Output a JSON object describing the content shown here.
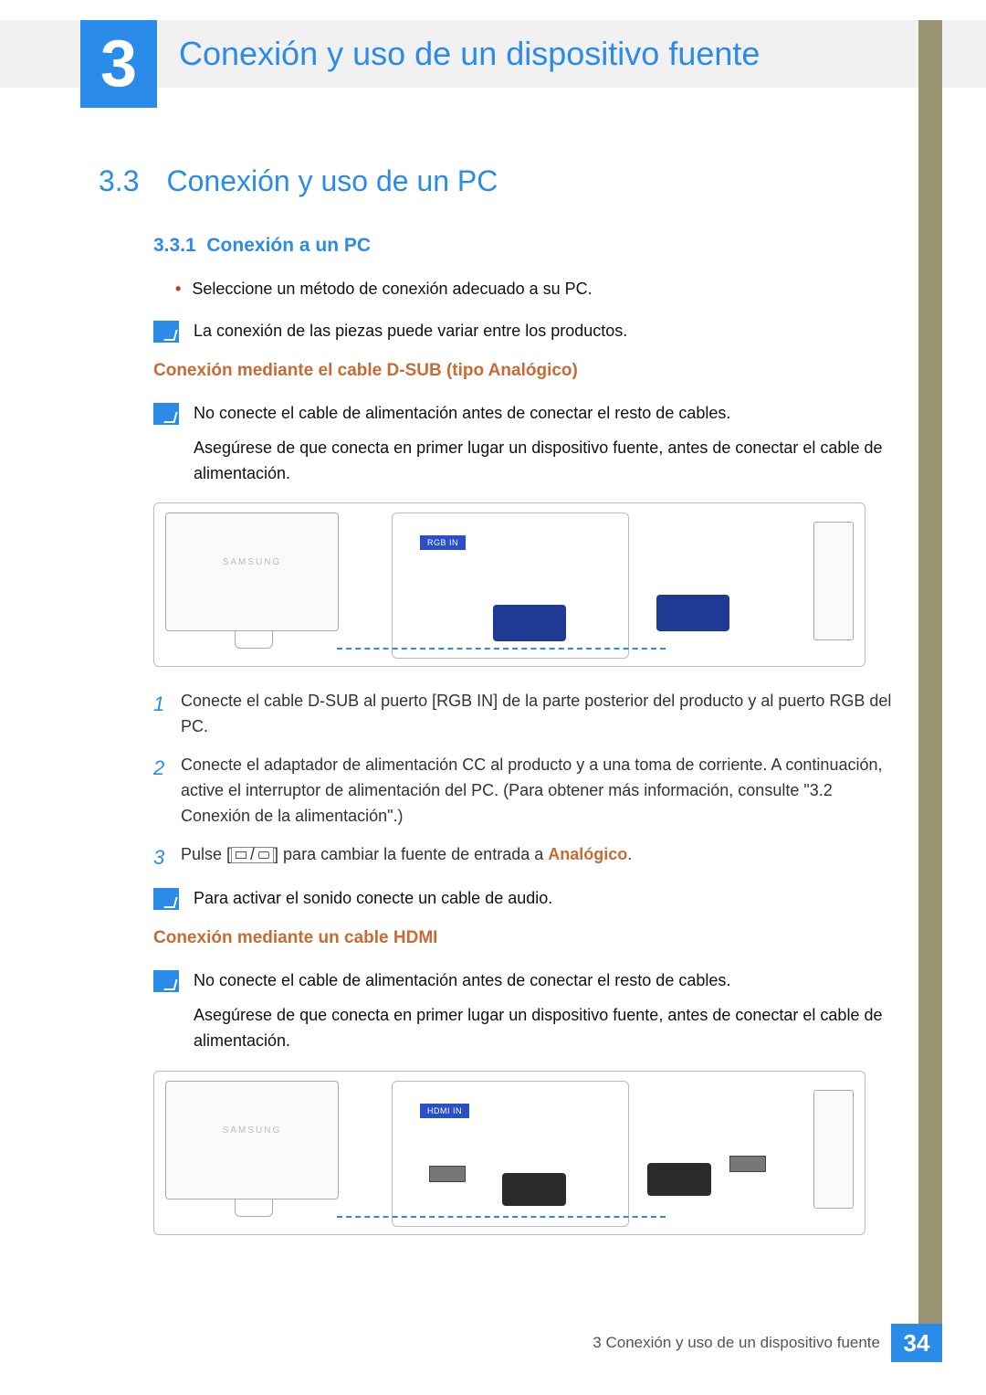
{
  "chapter": {
    "number": "3",
    "title": "Conexión y uso de un dispositivo fuente"
  },
  "section": {
    "number": "3.3",
    "title": "Conexión y uso de un PC"
  },
  "subsection": {
    "number": "3.3.1",
    "title": "Conexión a un PC"
  },
  "bullet1": "Seleccione un método de conexión adecuado a su PC.",
  "note1": "La conexión de las piezas puede variar entre los productos.",
  "sub1_title": "Conexión mediante el cable D-SUB (tipo Analógico)",
  "note2a": "No conecte el cable de alimentación antes de conectar el resto de cables.",
  "note2b": "Asegúrese de que conecta en primer lugar un dispositivo fuente, antes de conectar el cable de alimentación.",
  "diagram1": {
    "port_label": "RGB IN",
    "brand": "SAMSUNG"
  },
  "steps": {
    "s1": "Conecte el cable D-SUB al puerto [RGB IN] de la parte posterior del producto y al puerto RGB del PC.",
    "s2": "Conecte el adaptador de alimentación CC al producto y a una toma de corriente. A continuación, active el interruptor de alimentación del PC. (Para obtener más información, consulte \"3.2 Conexión de la alimentación\".)",
    "s3_pre": "Pulse [",
    "s3_post": "] para cambiar la fuente de entrada a ",
    "s3_mode": "Analógico",
    "s3_dot": "."
  },
  "note3": "Para activar el sonido conecte un cable de audio.",
  "sub2_title": "Conexión mediante un cable HDMI",
  "note4a": "No conecte el cable de alimentación antes de conectar el resto de cables.",
  "note4b": "Asegúrese de que conecta en primer lugar un dispositivo fuente, antes de conectar el cable de alimentación.",
  "diagram2": {
    "port_label": "HDMI IN",
    "brand": "SAMSUNG"
  },
  "footer": {
    "text": "3 Conexión y uso de un dispositivo fuente",
    "page": "34"
  }
}
